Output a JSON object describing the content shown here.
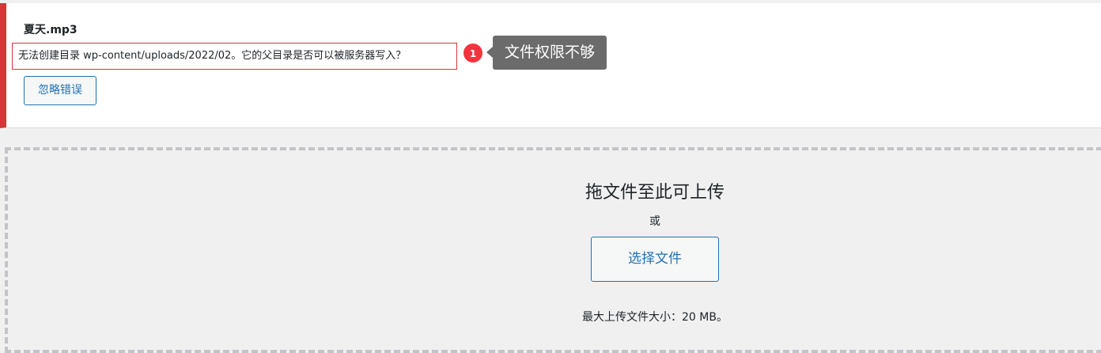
{
  "notice": {
    "filename": "夏天.mp3",
    "error_message": "无法创建目录 wp-content/uploads/2022/02。它的父目录是否可以被服务器写入？",
    "dismiss_label": "忽略错误",
    "accent_color": "#d63638"
  },
  "annotation": {
    "badge_number": "1",
    "callout_text": "文件权限不够",
    "badge_color": "#f5333f"
  },
  "uploader": {
    "drop_title": "拖文件至此可上传",
    "or_text": "或",
    "select_button_label": "选择文件",
    "max_size_text": "最大上传文件大小：20 MB。",
    "button_color": "#2271b1"
  }
}
